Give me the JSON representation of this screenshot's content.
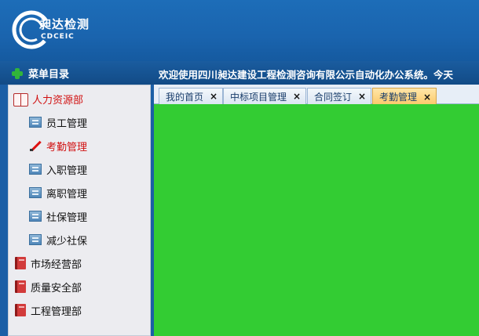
{
  "header": {
    "logo_cn": "昶达检测",
    "logo_en": "CDCEIC"
  },
  "menu": {
    "title": "菜单目录"
  },
  "welcome_text": "欢迎使用四川昶达建设工程检测咨询有限公示自动化办公系统。今天",
  "sidebar": {
    "items": [
      {
        "label": "人力资源部",
        "icon": "open-book-icon"
      },
      {
        "label": "员工管理",
        "icon": "doc-icon"
      },
      {
        "label": "考勤管理",
        "icon": "pencil-icon"
      },
      {
        "label": "入职管理",
        "icon": "doc-icon"
      },
      {
        "label": "离职管理",
        "icon": "doc-icon"
      },
      {
        "label": "社保管理",
        "icon": "doc-icon"
      },
      {
        "label": "减少社保",
        "icon": "doc-icon"
      },
      {
        "label": "市场经营部",
        "icon": "book-icon"
      },
      {
        "label": "质量安全部",
        "icon": "book-icon"
      },
      {
        "label": "工程管理部",
        "icon": "book-icon"
      }
    ]
  },
  "tabs": [
    {
      "label": "我的首页",
      "close": "×"
    },
    {
      "label": "中标项目管理",
      "close": "×"
    },
    {
      "label": "合同签订",
      "close": "×"
    },
    {
      "label": "考勤管理",
      "close": "×"
    }
  ],
  "colors": {
    "header_blue": "#1a64ae",
    "content_green": "#33cc33",
    "active_tab": "#fbc969",
    "active_red": "#d11111"
  }
}
